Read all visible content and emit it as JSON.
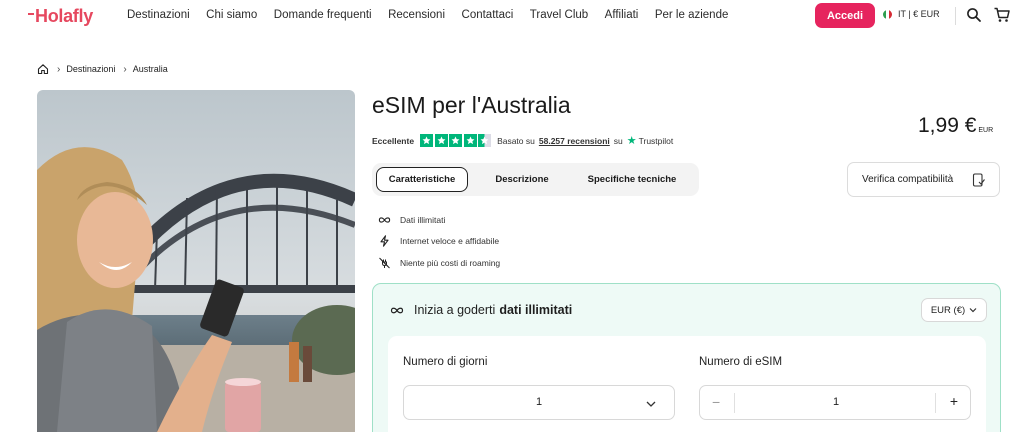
{
  "header": {
    "logo": "Holafly",
    "nav": [
      "Destinazioni",
      "Chi siamo",
      "Domande frequenti",
      "Recensioni",
      "Contattaci",
      "Travel Club",
      "Affiliati",
      "Per le aziende"
    ],
    "login_label": "Accedi",
    "locale_label": "IT | € EUR",
    "icons": [
      "search-icon",
      "cart-icon"
    ],
    "brand_color": "#e6485f",
    "login_color": "#e6245e"
  },
  "breadcrumb": {
    "home_icon": "home-icon",
    "items": [
      "Destinazioni",
      "Australia"
    ]
  },
  "product": {
    "title": "eSIM per l'Australia",
    "rating_label": "Eccellente",
    "rating_stars": 4.5,
    "reviews_prefix": "Basato su",
    "reviews_count": "58.257 recensioni",
    "reviews_suffix": "su",
    "trustpilot": "Trustpilot",
    "price": "1,99 €",
    "price_currency": "EUR",
    "tabs": [
      "Caratteristiche",
      "Descrizione",
      "Specifiche tecniche"
    ],
    "active_tab": "Caratteristiche",
    "verify_label": "Verifica compatibilità",
    "features": [
      {
        "icon": "infinity-icon",
        "label": "Dati illimitati"
      },
      {
        "icon": "lightning-icon",
        "label": "Internet veloce e affidabile"
      },
      {
        "icon": "no-roaming-icon",
        "label": "Niente più costi di roaming"
      }
    ]
  },
  "plan": {
    "heading_prefix": "Inizia a goderti",
    "heading_bold": "dati illimitati",
    "currency_select": "EUR (€)",
    "days_label": "Numero di giorni",
    "days_value": "1",
    "esim_label": "Numero di eSIM",
    "esim_value": "1",
    "accent_color": "#00b67a"
  }
}
